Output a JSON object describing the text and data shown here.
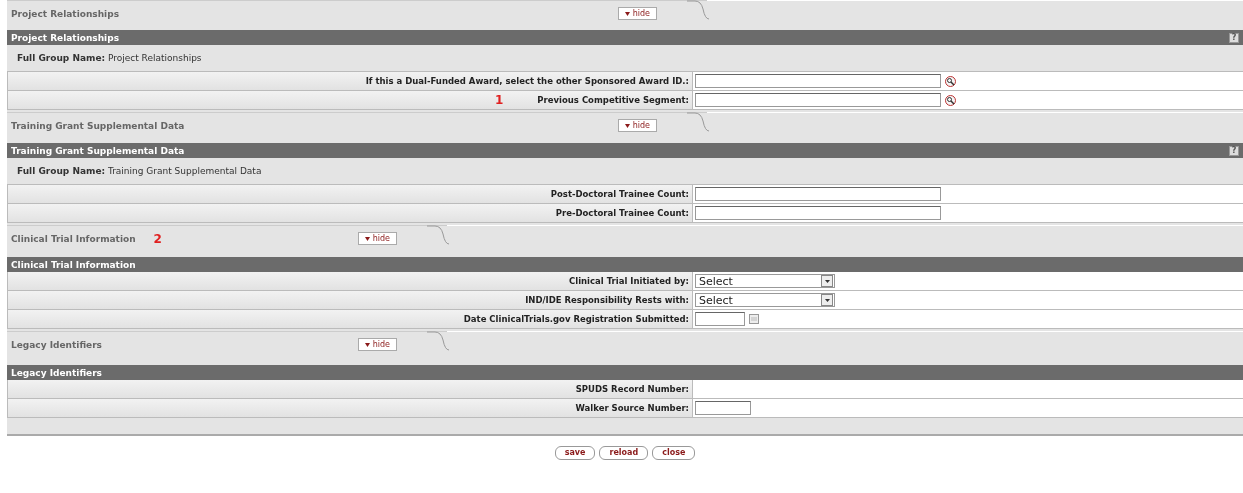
{
  "sections": [
    {
      "tab_title": "Project Relationships",
      "hide_label": "hide",
      "bar_title": "Project Relationships",
      "help": "?",
      "full_group_label": "Full Group Name:",
      "full_group_value": "Project Relationships",
      "fields": [
        {
          "label": "If this a Dual-Funded Award, select the other Sponsored Award ID.:",
          "kind": "lookup"
        },
        {
          "label": "Previous Competitive Segment:",
          "kind": "lookup",
          "annotation": "1"
        }
      ]
    },
    {
      "tab_title": "Training Grant Supplemental Data",
      "hide_label": "hide",
      "bar_title": "Training Grant Supplemental Data",
      "help": "?",
      "full_group_label": "Full Group Name:",
      "full_group_value": "Training Grant Supplemental Data",
      "fields": [
        {
          "label": "Post-Doctoral Trainee Count:",
          "kind": "text"
        },
        {
          "label": "Pre-Doctoral Trainee Count:",
          "kind": "text"
        }
      ]
    },
    {
      "tab_title": "Clinical Trial Information",
      "tab_annotation": "2",
      "hide_label": "hide",
      "bar_title": "Clinical Trial Information",
      "fields": [
        {
          "label": "Clinical Trial Initiated by:",
          "kind": "select",
          "value": "Select"
        },
        {
          "label": "IND/IDE Responsibility Rests with:",
          "kind": "select",
          "value": "Select"
        },
        {
          "label": "Date ClinicalTrials.gov Registration Submitted:",
          "kind": "date"
        }
      ]
    },
    {
      "tab_title": "Legacy Identifiers",
      "hide_label": "hide",
      "bar_title": "Legacy Identifiers",
      "fields": [
        {
          "label": "SPUDS Record Number:",
          "kind": "empty"
        },
        {
          "label": "Walker Source Number:",
          "kind": "short"
        }
      ]
    }
  ],
  "buttons": [
    "save",
    "reload",
    "close"
  ]
}
